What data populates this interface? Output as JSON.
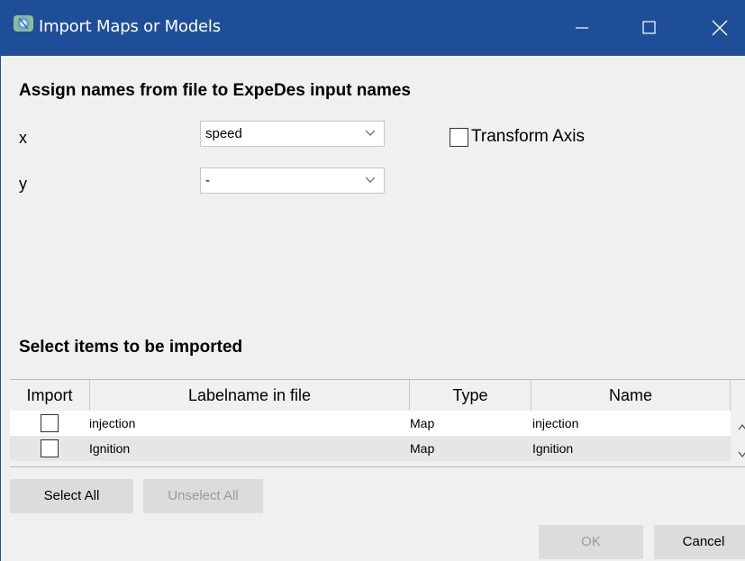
{
  "window": {
    "title": "Import Maps or Models",
    "colors": {
      "titlebar": "#1f4e99",
      "body": "#f0f0f0"
    },
    "controls": {
      "minimize_icon": "minimize-icon",
      "maximize_icon": "maximize-icon",
      "close_icon": "close-icon"
    }
  },
  "assign": {
    "heading": "Assign names from file to ExpeDes input names",
    "x_label": "x",
    "x_value": "speed",
    "y_label": "y",
    "y_value": "-",
    "transform_axis_label": "Transform Axis",
    "transform_axis_checked": false
  },
  "select": {
    "heading": "Select items to be imported",
    "columns": [
      "Import",
      "Labelname in file",
      "Type",
      "Name"
    ],
    "rows": [
      {
        "import": false,
        "label": "injection",
        "type": "Map",
        "name": "injection"
      },
      {
        "import": false,
        "label": "Ignition",
        "type": "Map",
        "name": "Ignition"
      }
    ]
  },
  "buttons": {
    "select_all": "Select All",
    "unselect_all": "Unselect All",
    "ok": "OK",
    "cancel": "Cancel"
  }
}
